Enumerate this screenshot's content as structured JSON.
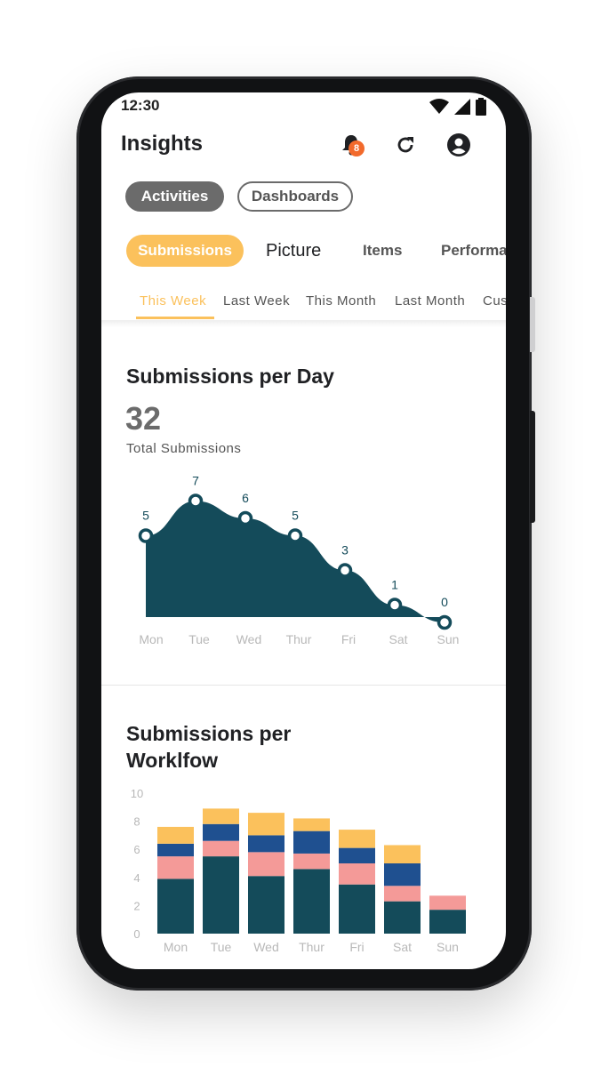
{
  "status_bar": {
    "time": "12:30"
  },
  "header": {
    "title": "Insights",
    "notification_count": "8"
  },
  "view_tabs": [
    {
      "label": "Activities"
    },
    {
      "label": "Dashboards"
    }
  ],
  "category_tabs": [
    {
      "label": "Submissions"
    },
    {
      "label": "Picture"
    },
    {
      "label": "Items"
    },
    {
      "label": "Performa"
    }
  ],
  "period_tabs": [
    {
      "label": "This Week"
    },
    {
      "label": "Last Week"
    },
    {
      "label": "This Month"
    },
    {
      "label": "Last Month"
    },
    {
      "label": "Cus"
    }
  ],
  "colors": {
    "accent": "#fbc15c",
    "primary": "#144b5a",
    "navy": "#1f5090",
    "pink": "#f49a98",
    "gray": "#6b6b6b"
  },
  "chart1": {
    "title": "Submissions per Day",
    "total": "32",
    "total_label": "Total Submissions"
  },
  "chart2": {
    "title_line1": "Submissions per",
    "title_line2": "Worklfow"
  },
  "chart_data": [
    {
      "type": "area",
      "title": "Submissions per Day",
      "categories": [
        "Mon",
        "Tue",
        "Wed",
        "Thur",
        "Fri",
        "Sat",
        "Sun"
      ],
      "values": [
        5,
        7,
        6,
        5,
        3,
        1,
        0
      ],
      "data_labels": [
        "5",
        "7",
        "6",
        "5",
        "3",
        "1",
        "0"
      ],
      "ylim": [
        0,
        8
      ],
      "grid": false,
      "color": "#144b5a"
    },
    {
      "type": "bar",
      "stacked": true,
      "title": "Submissions per Worklfow",
      "categories": [
        "Mon",
        "Tue",
        "Wed",
        "Thur",
        "Fri",
        "Sat",
        "Sun"
      ],
      "yticks": [
        "0",
        "2",
        "4",
        "6",
        "8",
        "10"
      ],
      "ylim": [
        0,
        10
      ],
      "grid": false,
      "series": [
        {
          "color": "#144b5a",
          "values": [
            3.9,
            5.5,
            4.1,
            4.6,
            3.5,
            2.3,
            1.7
          ]
        },
        {
          "color": "#f49a98",
          "values": [
            1.6,
            1.1,
            1.7,
            1.1,
            1.5,
            1.1,
            1.0
          ]
        },
        {
          "color": "#1f5090",
          "values": [
            0.9,
            1.2,
            1.2,
            1.6,
            1.1,
            1.6,
            0
          ]
        },
        {
          "color": "#fbc15c",
          "values": [
            1.2,
            1.1,
            1.6,
            0.9,
            1.3,
            1.3,
            0
          ]
        }
      ]
    }
  ]
}
